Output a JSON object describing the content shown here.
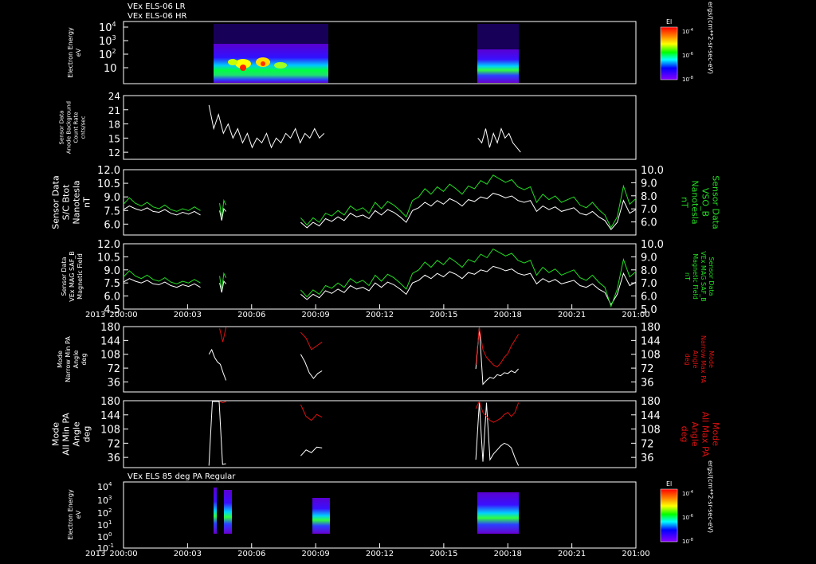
{
  "colors": {
    "background": "#000000",
    "axis": "#ffffff",
    "trace_white": "#ffffff",
    "trace_green": "#22dd22",
    "trace_red": "#dd1111"
  },
  "chart_data": [
    {
      "type": "heatmap",
      "id": "els_lr_hr",
      "titles": [
        "VEx ELS-06 LR",
        "VEx ELS-06 HR"
      ],
      "ylabel": [
        "Electron Energy",
        "eV"
      ],
      "scale": "log",
      "ylim": [
        1,
        20000
      ],
      "yticks": [
        "10",
        "10^2",
        "10^3",
        "10^4"
      ],
      "colorbar": {
        "label": "El",
        "ticks": [
          "10^-4",
          "10^-6",
          "10^-8"
        ],
        "unit": "ergs/(cm**2-sr-sec-eV)"
      },
      "time_blocks": [
        [
          "200:04.0",
          "200:09.4"
        ],
        [
          "200:16.6",
          "200:18.6"
        ]
      ]
    },
    {
      "type": "line",
      "id": "anode_background",
      "ylabel": [
        "Sensor Data",
        "Anode Background",
        "Count Rate",
        "cnts/sec"
      ],
      "ylim": [
        10.5,
        24
      ],
      "yticks": [
        12,
        15,
        18,
        21,
        24
      ],
      "series": [
        {
          "color": "#ffffff",
          "segments": [
            {
              "x_start": 4.0,
              "x_end": 9.4,
              "values": [
                22,
                17,
                20,
                16,
                18,
                15,
                17,
                14,
                16,
                13,
                15,
                14,
                16,
                13,
                15,
                14,
                16,
                15,
                17,
                14,
                16,
                15,
                17,
                15,
                16
              ]
            },
            {
              "x_start": 16.6,
              "x_end": 18.6,
              "values": [
                15,
                14,
                17,
                13,
                16,
                14,
                17,
                15,
                16,
                14,
                13,
                12
              ]
            }
          ]
        }
      ]
    },
    {
      "type": "line",
      "id": "sc_btot",
      "ylabel": [
        "Sensor Data",
        "S/C Btot",
        "Nanotesla",
        "nT"
      ],
      "y2label": [
        "Sensor Data",
        "VSO_B",
        "Nanotesla",
        "nT"
      ],
      "ylim": [
        4.8,
        12
      ],
      "yticks": [
        6.0,
        7.5,
        9.0,
        10.5,
        12.0
      ],
      "y2lim": [
        5.0,
        10.0
      ],
      "y2ticks": [
        6.0,
        7.0,
        8.0,
        9.0,
        10.0
      ],
      "series": [
        {
          "color": "#ffffff",
          "segments": [
            {
              "x_start": 0,
              "x_end": 3.6,
              "values": [
                7.6,
                8.0,
                7.7,
                7.5,
                7.8,
                7.4,
                7.3,
                7.6,
                7.2,
                7.0,
                7.3,
                7.1,
                7.4,
                7.0
              ]
            },
            {
              "x_start": 4.5,
              "x_end": 4.8,
              "values": [
                7.5,
                6.4,
                7.7,
                7.4
              ]
            },
            {
              "x_start": 8.3,
              "x_end": 24,
              "values": [
                6.2,
                5.6,
                6.2,
                5.8,
                6.6,
                6.3,
                6.8,
                6.4,
                7.2,
                6.8,
                7.0,
                6.6,
                7.5,
                7.0,
                7.6,
                7.3,
                6.8,
                6.2,
                7.5,
                7.8,
                8.4,
                8.0,
                8.6,
                8.2,
                8.8,
                8.5,
                8.0,
                8.7,
                8.5,
                9.0,
                8.8,
                9.4,
                9.2,
                8.9,
                9.1,
                8.6,
                8.4,
                8.6,
                7.4,
                8.0,
                7.6,
                7.9,
                7.4,
                7.6,
                7.8,
                7.2,
                7.0,
                7.4,
                6.8,
                6.4,
                5.4,
                6.2,
                8.6,
                7.2,
                7.6
              ]
            }
          ]
        },
        {
          "color": "#22dd22",
          "segments": [
            {
              "x_start": 0,
              "x_end": 3.6,
              "values": [
                8.2,
                8.9,
                8.3,
                8.0,
                8.4,
                7.9,
                7.7,
                8.1,
                7.6,
                7.4,
                7.7,
                7.5,
                7.9,
                7.5
              ]
            },
            {
              "x_start": 4.5,
              "x_end": 4.8,
              "values": [
                8.3,
                6.7,
                8.6,
                8.1
              ]
            },
            {
              "x_start": 8.3,
              "x_end": 24,
              "values": [
                6.7,
                5.9,
                6.7,
                6.2,
                7.2,
                6.9,
                7.5,
                7.0,
                8.0,
                7.5,
                7.8,
                7.2,
                8.4,
                7.7,
                8.5,
                8.1,
                7.5,
                6.8,
                8.6,
                9.0,
                9.9,
                9.3,
                10.1,
                9.6,
                10.4,
                9.9,
                9.3,
                10.2,
                9.9,
                10.8,
                10.4,
                11.4,
                11.0,
                10.6,
                10.9,
                10.1,
                9.8,
                10.1,
                8.4,
                9.3,
                8.7,
                9.1,
                8.4,
                8.7,
                9.0,
                8.1,
                7.8,
                8.4,
                7.6,
                7.0,
                5.6,
                6.8,
                10.2,
                8.2,
                8.8
              ]
            }
          ]
        }
      ]
    },
    {
      "type": "line",
      "id": "mag_saf_b",
      "ylabel": [
        "Sensor Data",
        "VEx MAG SAF_B",
        "Magnetic Field"
      ],
      "y2label": [
        "Sensor Data",
        "VEx MAG SAF_B",
        "Magnetic Field",
        "nT"
      ],
      "ylim": [
        4.5,
        12
      ],
      "yticks": [
        4.5,
        6.0,
        7.5,
        9.0,
        10.5,
        12.0
      ],
      "y2lim": [
        5.0,
        10.0
      ],
      "y2ticks": [
        5.0,
        6.0,
        7.0,
        8.0,
        9.0,
        10.0
      ],
      "xticks": [
        "200:00",
        "200:03",
        "200:06",
        "200:09",
        "200:12",
        "200:15",
        "200:18",
        "200:21",
        "201:00"
      ],
      "x_label_left": "2013",
      "series": [
        {
          "color": "#ffffff",
          "segments": [
            {
              "x_start": 0,
              "x_end": 3.6,
              "values": [
                7.6,
                8.0,
                7.7,
                7.5,
                7.8,
                7.4,
                7.3,
                7.6,
                7.2,
                7.0,
                7.3,
                7.1,
                7.4,
                7.0
              ]
            },
            {
              "x_start": 4.5,
              "x_end": 4.8,
              "values": [
                7.5,
                6.4,
                7.7,
                7.4
              ]
            },
            {
              "x_start": 8.3,
              "x_end": 24,
              "values": [
                6.2,
                5.6,
                6.2,
                5.8,
                6.6,
                6.3,
                6.8,
                6.4,
                7.2,
                6.8,
                7.0,
                6.6,
                7.5,
                7.0,
                7.6,
                7.3,
                6.8,
                6.2,
                7.5,
                7.8,
                8.4,
                8.0,
                8.6,
                8.2,
                8.8,
                8.5,
                8.0,
                8.7,
                8.5,
                9.0,
                8.8,
                9.4,
                9.2,
                8.9,
                9.1,
                8.6,
                8.4,
                8.6,
                7.4,
                8.0,
                7.6,
                7.9,
                7.4,
                7.6,
                7.8,
                7.2,
                7.0,
                7.4,
                6.8,
                6.4,
                5.0,
                6.2,
                8.6,
                7.2,
                7.6
              ]
            }
          ]
        },
        {
          "color": "#22dd22",
          "segments": [
            {
              "x_start": 0,
              "x_end": 3.6,
              "values": [
                8.2,
                8.9,
                8.3,
                8.0,
                8.4,
                7.9,
                7.7,
                8.1,
                7.6,
                7.4,
                7.7,
                7.5,
                7.9,
                7.5
              ]
            },
            {
              "x_start": 4.5,
              "x_end": 4.8,
              "values": [
                8.3,
                6.7,
                8.6,
                8.1
              ]
            },
            {
              "x_start": 8.3,
              "x_end": 24,
              "values": [
                6.7,
                5.9,
                6.7,
                6.2,
                7.2,
                6.9,
                7.5,
                7.0,
                8.0,
                7.5,
                7.8,
                7.2,
                8.4,
                7.7,
                8.5,
                8.1,
                7.5,
                6.8,
                8.6,
                9.0,
                9.9,
                9.3,
                10.1,
                9.6,
                10.4,
                9.9,
                9.3,
                10.2,
                9.9,
                10.8,
                10.4,
                11.4,
                11.0,
                10.6,
                10.9,
                10.1,
                9.8,
                10.1,
                8.4,
                9.3,
                8.7,
                9.1,
                8.4,
                8.7,
                9.0,
                8.1,
                7.8,
                8.4,
                7.6,
                7.0,
                4.8,
                6.8,
                10.2,
                8.2,
                8.8
              ]
            }
          ]
        }
      ]
    },
    {
      "type": "line",
      "id": "narrow_pa",
      "ylabel": [
        "Mode",
        "Narrow Min PA",
        "Angle",
        "deg"
      ],
      "y2label": [
        "Mode",
        "Narrow Max PA",
        "Angle",
        "deg"
      ],
      "ylim": [
        10,
        180
      ],
      "yticks": [
        36,
        72,
        108,
        144,
        180
      ],
      "y2ticks": [
        36,
        72,
        108,
        144,
        180
      ],
      "series": [
        {
          "color": "#ffffff",
          "segments": [
            {
              "x_start": 4.0,
              "x_end": 4.8,
              "values": [
                108,
                120,
                100,
                88,
                82,
                60,
                40
              ]
            },
            {
              "x_start": 8.3,
              "x_end": 9.3,
              "values": [
                108,
                88,
                60,
                45,
                58,
                65
              ]
            },
            {
              "x_start": 16.5,
              "x_end": 18.5,
              "values": [
                70,
                178,
                30,
                40,
                48,
                45,
                55,
                52,
                60,
                58,
                65,
                60,
                70
              ]
            }
          ]
        },
        {
          "color": "#dd1111",
          "segments": [
            {
              "x_start": 4.5,
              "x_end": 4.8,
              "values": [
                175,
                140,
                178
              ]
            },
            {
              "x_start": 8.3,
              "x_end": 9.3,
              "values": [
                165,
                150,
                120,
                130,
                140
              ]
            },
            {
              "x_start": 16.5,
              "x_end": 18.5,
              "values": [
                80,
                178,
                120,
                100,
                90,
                80,
                75,
                85,
                100,
                110,
                130,
                145,
                160
              ]
            }
          ]
        }
      ]
    },
    {
      "type": "line",
      "id": "all_pa",
      "ylabel": [
        "Mode",
        "All Min PA",
        "Angle",
        "deg"
      ],
      "y2label": [
        "Mode",
        "All Max PA",
        "Angle",
        "deg"
      ],
      "ylim": [
        10,
        180
      ],
      "yticks": [
        36,
        72,
        108,
        144,
        180
      ],
      "y2ticks": [
        36,
        72,
        108,
        144,
        180
      ],
      "series": [
        {
          "color": "#ffffff",
          "segments": [
            {
              "x_start": 4.0,
              "x_end": 4.8,
              "values": [
                15,
                178,
                178,
                178,
                18,
                20
              ]
            },
            {
              "x_start": 8.3,
              "x_end": 9.3,
              "values": [
                40,
                55,
                48,
                62,
                60
              ]
            },
            {
              "x_start": 16.5,
              "x_end": 18.5,
              "values": [
                30,
                175,
                25,
                175,
                30,
                45,
                55,
                65,
                72,
                68,
                60,
                35,
                15
              ]
            }
          ]
        },
        {
          "color": "#dd1111",
          "segments": [
            {
              "x_start": 4.5,
              "x_end": 4.8,
              "values": [
                178,
                175,
                178
              ]
            },
            {
              "x_start": 8.3,
              "x_end": 9.3,
              "values": [
                170,
                140,
                130,
                145,
                138
              ]
            },
            {
              "x_start": 16.5,
              "x_end": 18.5,
              "values": [
                160,
                178,
                150,
                140,
                130,
                125,
                130,
                135,
                145,
                150,
                140,
                150,
                175
              ]
            }
          ]
        }
      ]
    },
    {
      "type": "heatmap",
      "id": "els_85deg",
      "titles": [
        "VEx ELS 85 deg PA Regular"
      ],
      "ylabel": [
        "Electron Energy",
        "eV"
      ],
      "scale": "log",
      "ylim": [
        1,
        20000
      ],
      "yticks": [
        "10^-1",
        "10^0",
        "10^1",
        "10^2",
        "10^3",
        "10^4"
      ],
      "colorbar": {
        "label": "El",
        "ticks": [
          "10^-4",
          "10^-6",
          "10^-8"
        ],
        "unit": "ergs/(cm**2-sr-sec-eV)"
      },
      "xticks": [
        "200:00",
        "200:03",
        "200:06",
        "200:09",
        "200:12",
        "200:15",
        "200:18",
        "200:21",
        "201:00"
      ],
      "x_label_left": "2013",
      "time_blocks": [
        [
          "200:04.2",
          "200:04.4"
        ],
        [
          "200:04.5",
          "200:04.9"
        ],
        [
          "200:08.3",
          "200:09.2"
        ],
        [
          "200:16.4",
          "200:18.6"
        ]
      ]
    }
  ]
}
